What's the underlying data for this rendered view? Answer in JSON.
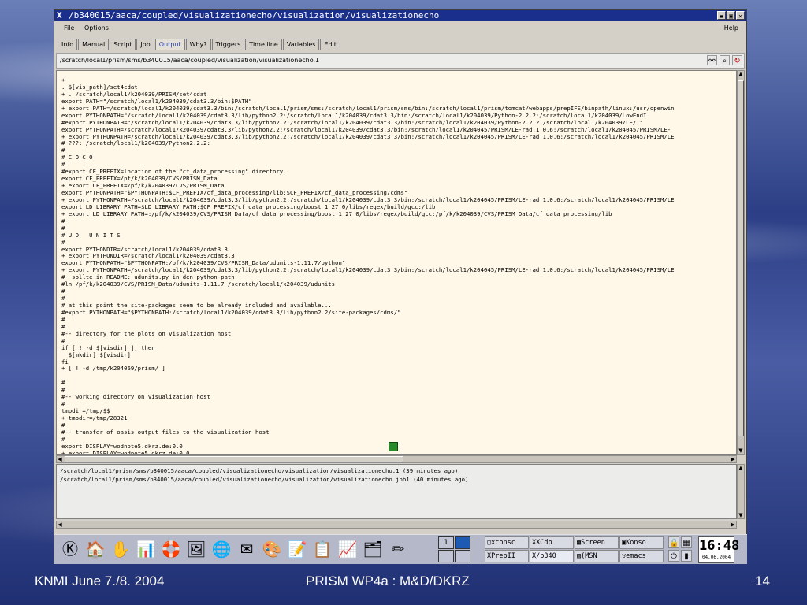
{
  "window": {
    "title": "/b340015/aaca/coupled/visualizationecho/visualization/visualizationecho",
    "x_icon": "X",
    "buttons": [
      "▪",
      "▣",
      "✕"
    ]
  },
  "menu": {
    "file": "File",
    "options": "Options",
    "help": "Help"
  },
  "tabs": [
    {
      "label": "Info",
      "active": false
    },
    {
      "label": "Manual",
      "active": false
    },
    {
      "label": "Script",
      "active": false
    },
    {
      "label": "Job",
      "active": false
    },
    {
      "label": "Output",
      "active": true
    },
    {
      "label": "Why?",
      "active": false
    },
    {
      "label": "Triggers",
      "active": false
    },
    {
      "label": "Time line",
      "active": false
    },
    {
      "label": "Variables",
      "active": false
    },
    {
      "label": "Edit",
      "active": false
    }
  ],
  "path": "/scratch/local1/prism/sms/b340015/aaca/coupled/visualization/visualizationecho.1",
  "path_icons": [
    "binoculars-icon",
    "search-icon",
    "reload-icon"
  ],
  "output_lines": [
    "+",
    ". $[vis_path]/set4cdat",
    "+ . /scratch/local1/k204039/PRISM/set4cdat",
    "export PATH=\"/scratch/local1/k204039/cdat3.3/bin:$PATH\"",
    "+ export PATH=/scratch/local1/k204039/cdat3.3/bin:/scratch/local1/prism/sms:/scratch/local1/prism/sms/bin:/scratch/local1/prism/tomcat/webapps/prepIFS/binpath/linux:/usr/openwin",
    "export PYTHONPATH=\"/scratch/local1/k204039/cdat3.3/lib/python2.2:/scratch/local1/k204039/cdat3.3/bin:/scratch/local1/k204039/Python-2.2.2:/scratch/local1/k204039/LowEndI",
    "#export PYTHONPATH=\"/scratch/local1/k204039/cdat3.3/lib/python2.2:/scratch/local1/k204039/cdat3.3/bin:/scratch/local1/k204039/Python-2.2.2:/scratch/local1/k204039/LE/:\"",
    "export PYTHONPATH=/scratch/local1/k204039/cdat3.3/lib/python2.2:/scratch/local1/k204039/cdat3.3/bin:/scratch/local1/k204045/PRISM/LE-rad.1.0.6:/scratch/local1/k204045/PRISM/LE-",
    "+ export PYTHONPATH=/scratch/local1/k204039/cdat3.3/lib/python2.2:/scratch/local1/k204039/cdat3.3/bin:/scratch/local1/k204045/PRISM/LE-rad.1.0.6:/scratch/local1/k204045/PRISM/LE",
    "# ???: /scratch/local1/k204039/Python2.2.2:",
    "#",
    "# C O C O",
    "#",
    "#export CF_PREFIX=location of the \"cf_data_processing\" directory.",
    "export CF_PREFIX=/pf/k/k204039/CVS/PRISM_Data",
    "+ export CF_PREFIX=/pf/k/k204039/CVS/PRISM_Data",
    "export PYTHONPATH=\"$PYTHONPATH:$CF_PREFIX/cf_data_processing/lib:$CF_PREFIX/cf_data_processing/cdms\"",
    "+ export PYTHONPATH=/scratch/local1/k204039/cdat3.3/lib/python2.2:/scratch/local1/k204039/cdat3.3/bin:/scratch/local1/k204045/PRISM/LE-rad.1.0.6:/scratch/local1/k204045/PRISM/LE",
    "export LD_LIBRARY_PATH=$LD_LIBRARY_PATH:$CF_PREFIX/cf_data_processing/boost_1_27_0/libs/regex/build/gcc:/lib",
    "+ export LD_LIBRARY_PATH=:/pf/k/k204039/CVS/PRISM_Data/cf_data_processing/boost_1_27_0/libs/regex/build/gcc:/pf/k/k204039/CVS/PRISM_Data/cf_data_processing/lib",
    "#",
    "#",
    "# U D   U N I T S",
    "#",
    "export PYTHONDIR=/scratch/local1/k204039/cdat3.3",
    "+ export PYTHONDIR=/scratch/local1/k204039/cdat3.3",
    "export PYTHONPATH=\"$PYTHONPATH:/pf/k/k204039/CVS/PRISM_Data/udunits-1.11.7/python\"",
    "+ export PYTHONPATH=/scratch/local1/k204039/cdat3.3/lib/python2.2:/scratch/local1/k204039/cdat3.3/bin:/scratch/local1/k204045/PRISM/LE-rad.1.0.6:/scratch/local1/k204045/PRISM/LE",
    "#  sollte in README: udunits.py in den python-path",
    "#ln /pf/k/k204039/CVS/PRISM_Data/udunits-1.11.7 /scratch/local1/k204039/udunits",
    "#",
    "#",
    "# at this point the site-packages seem to be already included and available...",
    "#export PYTHONPATH=\"$PYTHONPATH:/scratch/local1/k204039/cdat3.3/lib/python2.2/site-packages/cdms/\"",
    "#",
    "#",
    "#-- directory for the plots on visualization host",
    "#",
    "if [ ! -d $[visdir] ]; then",
    "  $[mkdir] $[visdir]",
    "fi",
    "+ [ ! -d /tmp/k204069/prism/ ]",
    "",
    "#",
    "#",
    "#-- working directory on visualization host",
    "#",
    "tmpdir=/tmp/$$",
    "+ tmpdir=/tmp/28321",
    "#",
    "#-- transfer of oasis output files to the visualization host",
    "#",
    "export DISPLAY=wodnote5.dkrz.de:0.0",
    "+ export DISPLAY=wodnote5.dkrz.de:0.0"
  ],
  "log": [
    "/scratch/local1/prism/sms/b340015/aaca/coupled/visualizationecho/visualization/visualizationecho.1 (39 minutes ago)",
    "/scratch/local1/prism/sms/b340015/aaca/coupled/visualizationecho/visualization/visualizationecho.job1 (40 minutes ago)"
  ],
  "taskbar": {
    "launchers": [
      {
        "name": "kde-menu-icon",
        "glyph": "Ⓚ"
      },
      {
        "name": "home-folder-icon",
        "glyph": "🏠"
      },
      {
        "name": "hand-icon",
        "glyph": "✋"
      },
      {
        "name": "chart-tool-icon",
        "glyph": "📊"
      },
      {
        "name": "lifebuoy-icon",
        "glyph": "🛟"
      },
      {
        "name": "image-viewer-icon",
        "glyph": "🖼"
      },
      {
        "name": "globe-browser-icon",
        "glyph": "🌐"
      },
      {
        "name": "mail-icon",
        "glyph": "✉"
      },
      {
        "name": "paint-icon",
        "glyph": "🎨"
      },
      {
        "name": "office-icon",
        "glyph": "📝"
      },
      {
        "name": "spreadsheet-icon",
        "glyph": "📋"
      },
      {
        "name": "graph-icon",
        "glyph": "📈"
      },
      {
        "name": "presentation-icon",
        "glyph": "🗂"
      },
      {
        "name": "pen-tool-icon",
        "glyph": "✏"
      }
    ],
    "desktops": [
      "1",
      "",
      "",
      ""
    ],
    "tasks": [
      {
        "label": "xconsc",
        "icon": "▢"
      },
      {
        "label": "XCdp",
        "icon": "X"
      },
      {
        "label": "Screen",
        "icon": "▩"
      },
      {
        "label": "Konso",
        "icon": "▣"
      },
      {
        "label": "PrepII",
        "icon": "X"
      },
      {
        "label": "/b340",
        "icon": "X"
      },
      {
        "label": "(MSN",
        "icon": "▨"
      },
      {
        "label": "emacs",
        "icon": "♉"
      }
    ],
    "tray": [
      "🔒",
      "▦",
      "⏻",
      "▮"
    ],
    "clock_time": "16:48",
    "clock_date": "04.06.2004"
  },
  "footer": {
    "left": "KNMI June 7./8. 2004",
    "center": "PRISM WP4a :  M&D/DKRZ",
    "page": "14"
  }
}
